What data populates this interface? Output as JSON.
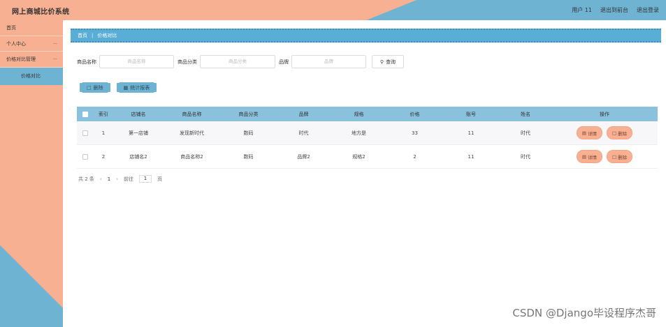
{
  "header": {
    "brand": "网上商城比价系统",
    "links": [
      "用户 11",
      "退出到前台",
      "退出登录"
    ]
  },
  "sidebar": {
    "items": [
      {
        "label": "首页"
      },
      {
        "label": "个人中心"
      },
      {
        "label": "价格对比管理"
      }
    ],
    "sub_item": "价格对比"
  },
  "breadcrumb": {
    "home": "首页",
    "current": "价格对比"
  },
  "filters": {
    "name_label": "商品名称",
    "name_placeholder": "商品名称",
    "category_label": "商品分类",
    "category_placeholder": "商品分类",
    "brand_label": "品牌",
    "brand_placeholder": "品牌",
    "query_label": "查询"
  },
  "actions": {
    "delete_label": "删除",
    "report_label": "统计报表"
  },
  "table": {
    "headers": [
      "索引",
      "店铺名",
      "商品名称",
      "商品分类",
      "品牌",
      "规格",
      "价格",
      "账号",
      "姓名",
      "操作"
    ],
    "rows": [
      {
        "index": "1",
        "shop": "第一店铺",
        "product": "发现新时代",
        "category": "数码",
        "brand": "时代",
        "spec": "地方是",
        "price": "33",
        "account": "11",
        "name": "时代"
      },
      {
        "index": "2",
        "shop": "店铺名2",
        "product": "商品名称2",
        "category": "数码",
        "brand": "品牌2",
        "spec": "规格2",
        "price": "2",
        "account": "11",
        "name": "时代"
      }
    ],
    "detail_label": "详情",
    "delete_label": "删除"
  },
  "pager": {
    "total": "共 2 条",
    "prev": "‹",
    "page": "1",
    "next": "›",
    "goto": "前往",
    "goto_value": "1",
    "unit": "页"
  },
  "watermark": "CSDN @Django毕设程序杰哥",
  "colors": {
    "peach": "#f7b192",
    "blue": "#6fb3d3",
    "table_header": "#8ac1dd"
  }
}
